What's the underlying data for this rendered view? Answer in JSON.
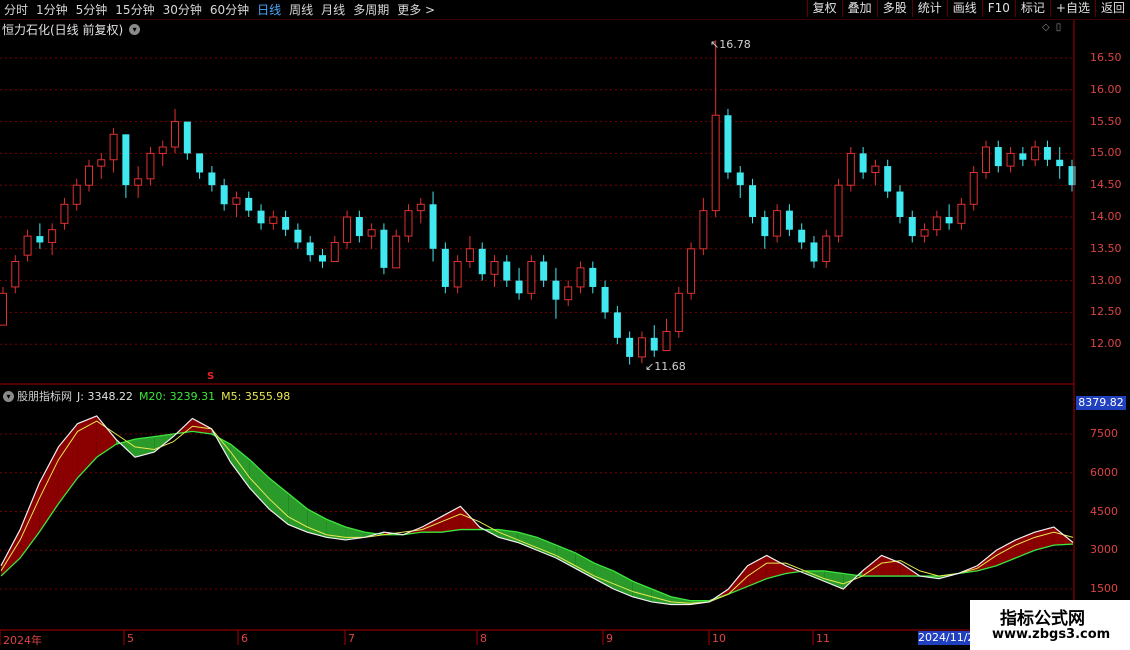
{
  "toolbar": {
    "periods": [
      "分时",
      "1分钟",
      "5分钟",
      "15分钟",
      "30分钟",
      "60分钟",
      "日线",
      "周线",
      "月线",
      "多周期",
      "更多 >"
    ],
    "active": "日线",
    "tools": [
      "复权",
      "叠加",
      "多股",
      "统计",
      "画线",
      "F10",
      "标记",
      "+自选",
      "返回"
    ]
  },
  "title": "恒力石化(日线 前复权)",
  "price_ticks": [
    "16.50",
    "16.00",
    "15.50",
    "15.00",
    "14.50",
    "14.00",
    "13.50",
    "13.00",
    "12.50",
    "12.00"
  ],
  "annotations": {
    "high": "16.78",
    "low": "11.68",
    "mark": "S"
  },
  "indicator": {
    "name": "股朋指标网",
    "j": "J: 3348.22",
    "m20": "M20: 3239.31",
    "m5": "M5: 3555.98",
    "current": "8379.82",
    "ticks": [
      "7500",
      "6000",
      "4500",
      "3000",
      "1500"
    ]
  },
  "x_labels": [
    "2024年",
    "5",
    "6",
    "7",
    "8",
    "9",
    "10",
    "11"
  ],
  "date_box": "2024/11/2",
  "watermark": {
    "line1": "指标公式网",
    "line2": "www.zbgs3.com"
  },
  "colors": {
    "up": "#e03030",
    "down": "#40e8f0",
    "ma_fast": "#e8e850",
    "ma_slow": "#3ce63c",
    "fill_up": "#8b0000",
    "fill_down": "#2a9a2a",
    "grid": "#7a0000"
  },
  "chart_data": {
    "type": "candlestick",
    "price": {
      "ylim": [
        11.5,
        16.9
      ],
      "ohlc": [
        [
          12.3,
          12.9,
          12.3,
          12.8
        ],
        [
          12.9,
          13.4,
          12.8,
          13.3
        ],
        [
          13.4,
          13.8,
          13.3,
          13.7
        ],
        [
          13.7,
          13.9,
          13.5,
          13.6
        ],
        [
          13.6,
          13.9,
          13.4,
          13.8
        ],
        [
          13.9,
          14.3,
          13.8,
          14.2
        ],
        [
          14.2,
          14.6,
          14.1,
          14.5
        ],
        [
          14.5,
          14.9,
          14.4,
          14.8
        ],
        [
          14.8,
          15.0,
          14.6,
          14.9
        ],
        [
          14.9,
          15.4,
          14.7,
          15.3
        ],
        [
          15.3,
          15.3,
          14.3,
          14.5
        ],
        [
          14.5,
          14.8,
          14.3,
          14.6
        ],
        [
          14.6,
          15.1,
          14.5,
          15.0
        ],
        [
          15.0,
          15.2,
          14.8,
          15.1
        ],
        [
          15.1,
          15.7,
          15.0,
          15.5
        ],
        [
          15.5,
          15.5,
          14.9,
          15.0
        ],
        [
          15.0,
          15.0,
          14.6,
          14.7
        ],
        [
          14.7,
          14.8,
          14.4,
          14.5
        ],
        [
          14.5,
          14.6,
          14.1,
          14.2
        ],
        [
          14.2,
          14.4,
          14.0,
          14.3
        ],
        [
          14.3,
          14.4,
          14.0,
          14.1
        ],
        [
          14.1,
          14.2,
          13.8,
          13.9
        ],
        [
          13.9,
          14.1,
          13.8,
          14.0
        ],
        [
          14.0,
          14.1,
          13.7,
          13.8
        ],
        [
          13.8,
          13.9,
          13.5,
          13.6
        ],
        [
          13.6,
          13.7,
          13.3,
          13.4
        ],
        [
          13.4,
          13.5,
          13.2,
          13.3
        ],
        [
          13.3,
          13.7,
          13.3,
          13.6
        ],
        [
          13.6,
          14.1,
          13.5,
          14.0
        ],
        [
          14.0,
          14.1,
          13.6,
          13.7
        ],
        [
          13.7,
          13.9,
          13.5,
          13.8
        ],
        [
          13.8,
          13.9,
          13.1,
          13.2
        ],
        [
          13.2,
          13.8,
          13.2,
          13.7
        ],
        [
          13.7,
          14.2,
          13.6,
          14.1
        ],
        [
          14.1,
          14.3,
          13.9,
          14.2
        ],
        [
          14.2,
          14.4,
          13.3,
          13.5
        ],
        [
          13.5,
          13.6,
          12.8,
          12.9
        ],
        [
          12.9,
          13.4,
          12.8,
          13.3
        ],
        [
          13.3,
          13.7,
          13.2,
          13.5
        ],
        [
          13.5,
          13.6,
          13.0,
          13.1
        ],
        [
          13.1,
          13.4,
          12.9,
          13.3
        ],
        [
          13.3,
          13.4,
          12.9,
          13.0
        ],
        [
          13.0,
          13.2,
          12.7,
          12.8
        ],
        [
          12.8,
          13.4,
          12.7,
          13.3
        ],
        [
          13.3,
          13.4,
          12.9,
          13.0
        ],
        [
          13.0,
          13.2,
          12.4,
          12.7
        ],
        [
          12.7,
          13.0,
          12.6,
          12.9
        ],
        [
          12.9,
          13.3,
          12.8,
          13.2
        ],
        [
          13.2,
          13.3,
          12.8,
          12.9
        ],
        [
          12.9,
          13.0,
          12.4,
          12.5
        ],
        [
          12.5,
          12.6,
          12.0,
          12.1
        ],
        [
          12.1,
          12.2,
          11.68,
          11.8
        ],
        [
          11.8,
          12.2,
          11.7,
          12.1
        ],
        [
          12.1,
          12.3,
          11.8,
          11.9
        ],
        [
          11.9,
          12.4,
          11.9,
          12.2
        ],
        [
          12.2,
          12.9,
          12.1,
          12.8
        ],
        [
          12.8,
          13.6,
          12.7,
          13.5
        ],
        [
          13.5,
          14.3,
          13.4,
          14.1
        ],
        [
          14.1,
          16.78,
          14.0,
          15.6
        ],
        [
          15.6,
          15.7,
          14.6,
          14.7
        ],
        [
          14.7,
          14.8,
          14.3,
          14.5
        ],
        [
          14.5,
          14.6,
          13.9,
          14.0
        ],
        [
          14.0,
          14.1,
          13.5,
          13.7
        ],
        [
          13.7,
          14.2,
          13.6,
          14.1
        ],
        [
          14.1,
          14.2,
          13.7,
          13.8
        ],
        [
          13.8,
          13.9,
          13.5,
          13.6
        ],
        [
          13.6,
          13.7,
          13.2,
          13.3
        ],
        [
          13.3,
          13.8,
          13.2,
          13.7
        ],
        [
          13.7,
          14.6,
          13.6,
          14.5
        ],
        [
          14.5,
          15.1,
          14.4,
          15.0
        ],
        [
          15.0,
          15.1,
          14.6,
          14.7
        ],
        [
          14.7,
          14.9,
          14.5,
          14.8
        ],
        [
          14.8,
          14.9,
          14.3,
          14.4
        ],
        [
          14.4,
          14.5,
          13.9,
          14.0
        ],
        [
          14.0,
          14.1,
          13.6,
          13.7
        ],
        [
          13.7,
          13.9,
          13.6,
          13.8
        ],
        [
          13.8,
          14.1,
          13.7,
          14.0
        ],
        [
          14.0,
          14.2,
          13.8,
          13.9
        ],
        [
          13.9,
          14.3,
          13.8,
          14.2
        ],
        [
          14.2,
          14.8,
          14.1,
          14.7
        ],
        [
          14.7,
          15.2,
          14.6,
          15.1
        ],
        [
          15.1,
          15.2,
          14.7,
          14.8
        ],
        [
          14.8,
          15.1,
          14.7,
          15.0
        ],
        [
          15.0,
          15.1,
          14.8,
          14.9
        ],
        [
          14.9,
          15.2,
          14.8,
          15.1
        ],
        [
          15.1,
          15.2,
          14.8,
          14.9
        ],
        [
          14.9,
          15.1,
          14.6,
          14.8
        ],
        [
          14.8,
          14.9,
          14.4,
          14.5
        ]
      ]
    },
    "indicator": {
      "ylim": [
        800,
        9000
      ],
      "j": [
        2400,
        3800,
        5600,
        7000,
        7900,
        8200,
        7300,
        6600,
        6800,
        7400,
        8100,
        7700,
        6400,
        5400,
        4600,
        4000,
        3700,
        3500,
        3400,
        3500,
        3700,
        3600,
        3900,
        4300,
        4700,
        3900,
        3500,
        3300,
        3000,
        2700,
        2300,
        1900,
        1500,
        1200,
        1000,
        900,
        900,
        1000,
        1500,
        2400,
        2800,
        2400,
        2100,
        1800,
        1500,
        2200,
        2800,
        2500,
        2000,
        1900,
        2100,
        2400,
        3000,
        3400,
        3700,
        3900,
        3300
      ],
      "m5": [
        2200,
        3400,
        5000,
        6500,
        7600,
        8000,
        7500,
        7000,
        6900,
        7200,
        7800,
        7700,
        6800,
        5800,
        5000,
        4300,
        3900,
        3600,
        3500,
        3500,
        3600,
        3700,
        3800,
        4100,
        4400,
        4100,
        3700,
        3400,
        3100,
        2800,
        2400,
        2000,
        1700,
        1400,
        1200,
        1000,
        950,
        1000,
        1300,
        2000,
        2500,
        2500,
        2200,
        1900,
        1700,
        2000,
        2500,
        2600,
        2200,
        2000,
        2100,
        2300,
        2800,
        3200,
        3500,
        3700,
        3500
      ],
      "m20": [
        2000,
        2700,
        3700,
        4800,
        5800,
        6600,
        7100,
        7300,
        7400,
        7500,
        7600,
        7500,
        7100,
        6500,
        5800,
        5200,
        4600,
        4200,
        3900,
        3700,
        3600,
        3600,
        3700,
        3700,
        3800,
        3800,
        3800,
        3700,
        3500,
        3200,
        2900,
        2500,
        2200,
        1800,
        1500,
        1200,
        1050,
        1050,
        1300,
        1600,
        1900,
        2100,
        2200,
        2200,
        2100,
        2000,
        2000,
        2000,
        2000,
        2000,
        2100,
        2200,
        2400,
        2700,
        3000,
        3200,
        3240
      ]
    }
  }
}
